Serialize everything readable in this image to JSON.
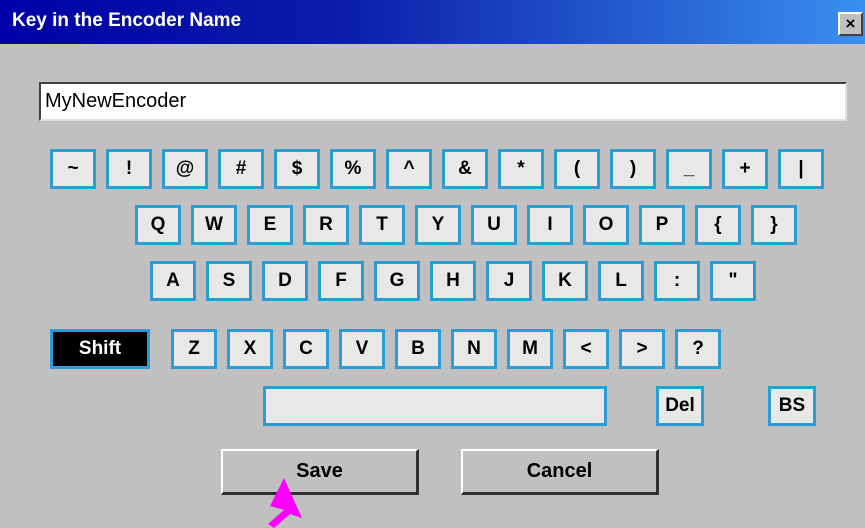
{
  "window": {
    "title": "Key in the Encoder Name",
    "close_label": "×"
  },
  "input": {
    "value": "MyNewEncoder"
  },
  "keyboard": {
    "row1": [
      "~",
      "!",
      "@",
      "#",
      "$",
      "%",
      "^",
      "&",
      "*",
      "(",
      ")",
      "_",
      "+",
      "|"
    ],
    "row2": [
      "Q",
      "W",
      "E",
      "R",
      "T",
      "Y",
      "U",
      "I",
      "O",
      "P",
      "{",
      "}"
    ],
    "row3": [
      "A",
      "S",
      "D",
      "F",
      "G",
      "H",
      "J",
      "K",
      "L",
      ":",
      "\""
    ],
    "row4": [
      "Z",
      "X",
      "C",
      "V",
      "B",
      "N",
      "M",
      "<",
      ">",
      "?"
    ],
    "shift_label": "Shift",
    "del_label": "Del",
    "bs_label": "BS",
    "space_label": ""
  },
  "buttons": {
    "save": "Save",
    "cancel": "Cancel"
  },
  "colors": {
    "key_border": "#2e9cd4",
    "key_fill": "#e8e8e8",
    "cursor": "#ff00ff",
    "title_start": "#0000a8",
    "title_end": "#3a8ff0"
  }
}
